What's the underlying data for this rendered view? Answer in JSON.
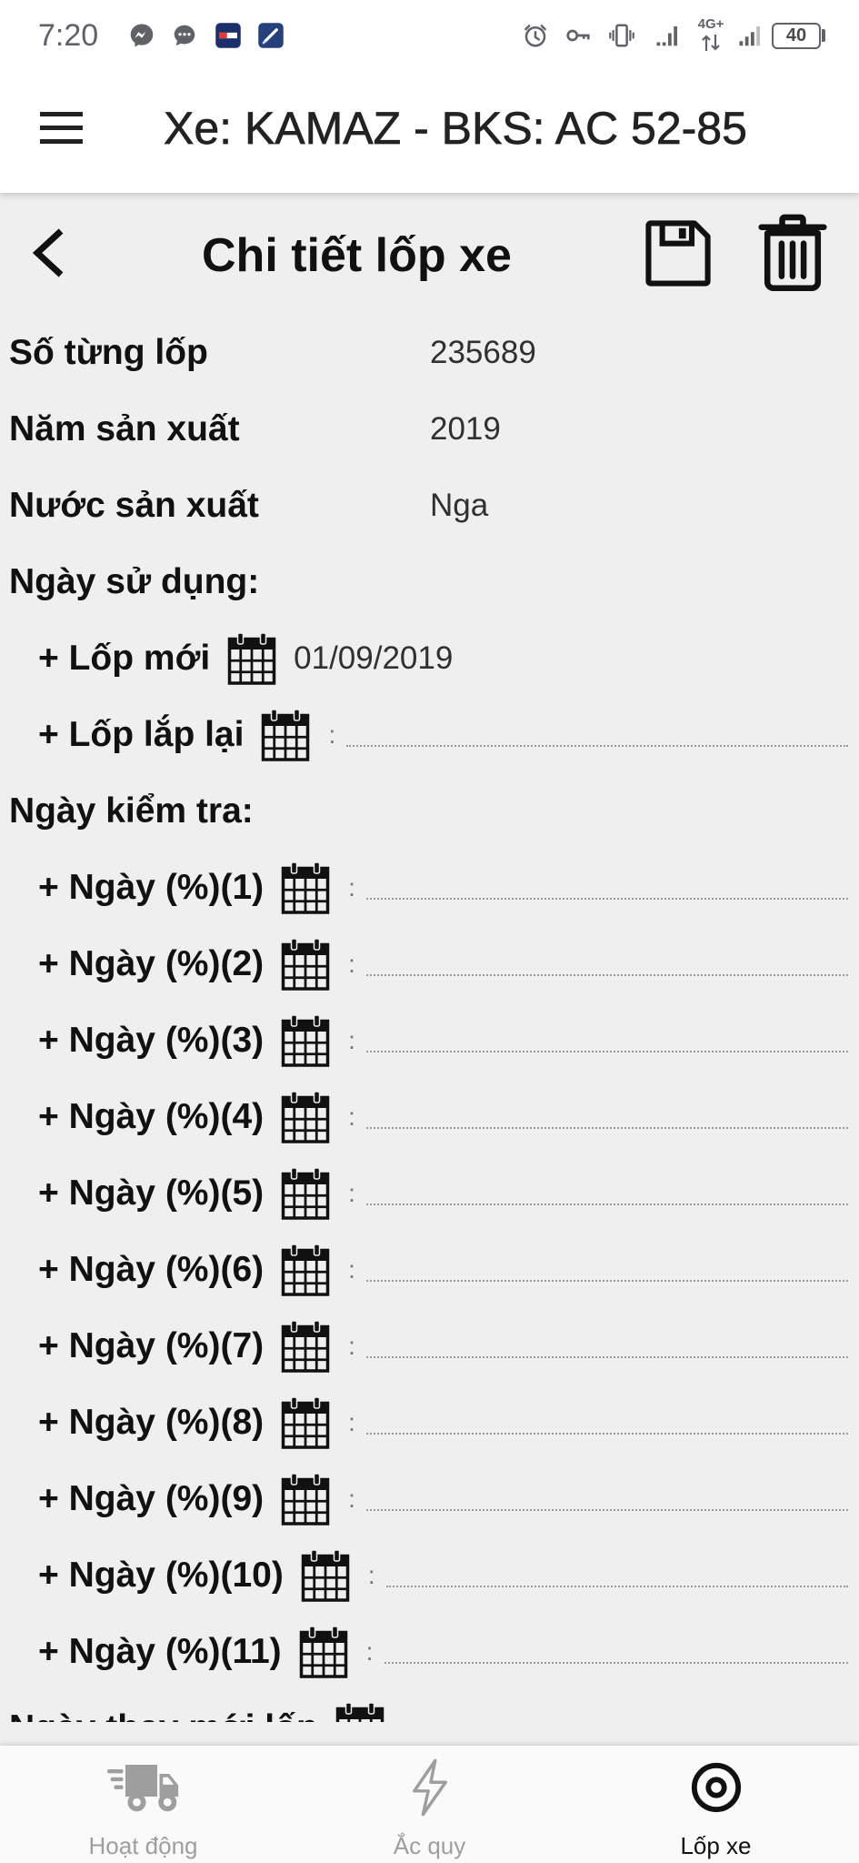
{
  "status_bar": {
    "time": "7:20",
    "network_type": "4G+",
    "battery_level": "40",
    "left_icons": [
      "messenger-icon",
      "chat-icon",
      "app-notification-icon",
      "pen-app-icon"
    ],
    "right_icons": [
      "alarm-icon",
      "key-icon",
      "vibrate-icon",
      "signal-icon",
      "network-arrows-icon",
      "signal-icon",
      "battery-icon"
    ]
  },
  "app_bar": {
    "menu_icon": "menu-icon",
    "title": "Xe: KAMAZ - BKS: AC 52-85"
  },
  "detail_header": {
    "back_icon": "back-arrow-icon",
    "title": "Chi tiết lốp xe",
    "save_icon": "save-icon",
    "delete_icon": "trash-icon"
  },
  "tire_info": [
    {
      "label": "Số từng lốp",
      "value": "235689"
    },
    {
      "label": "Năm sản xuất",
      "value": "2019"
    },
    {
      "label": "Nước sản xuất",
      "value": "Nga"
    }
  ],
  "usage_dates": {
    "heading": "Ngày sử dụng:",
    "items": [
      {
        "label": "+ Lốp mới",
        "value": "01/09/2019"
      },
      {
        "label": "+ Lốp lắp lại",
        "value": ""
      }
    ]
  },
  "inspection_dates": {
    "heading": "Ngày kiểm tra:",
    "items": [
      {
        "label": "+ Ngày (%)(1)",
        "value": ""
      },
      {
        "label": "+ Ngày (%)(2)",
        "value": ""
      },
      {
        "label": "+ Ngày (%)(3)",
        "value": ""
      },
      {
        "label": "+ Ngày (%)(4)",
        "value": ""
      },
      {
        "label": "+ Ngày (%)(5)",
        "value": ""
      },
      {
        "label": "+ Ngày (%)(6)",
        "value": ""
      },
      {
        "label": "+ Ngày (%)(7)",
        "value": ""
      },
      {
        "label": "+ Ngày (%)(8)",
        "value": ""
      },
      {
        "label": "+ Ngày (%)(9)",
        "value": ""
      },
      {
        "label": "+ Ngày (%)(10)",
        "value": ""
      },
      {
        "label": "+ Ngày (%)(11)",
        "value": ""
      }
    ]
  },
  "replacement_date": {
    "label": "Ngày thay mới lốp"
  },
  "empty_date_marker": ":",
  "date_picker_icon": "calendar-icon",
  "bottom_nav": {
    "items": [
      {
        "label": "Hoạt động",
        "icon": "truck-icon",
        "active": false
      },
      {
        "label": "Ắc quy",
        "icon": "lightning-icon",
        "active": false
      },
      {
        "label": "Lốp xe",
        "icon": "tire-icon",
        "active": true
      }
    ]
  },
  "colors": {
    "active": "#111111",
    "inactive": "#9e9e9e",
    "background": "#efefef",
    "app_bar": "#ffffff"
  }
}
